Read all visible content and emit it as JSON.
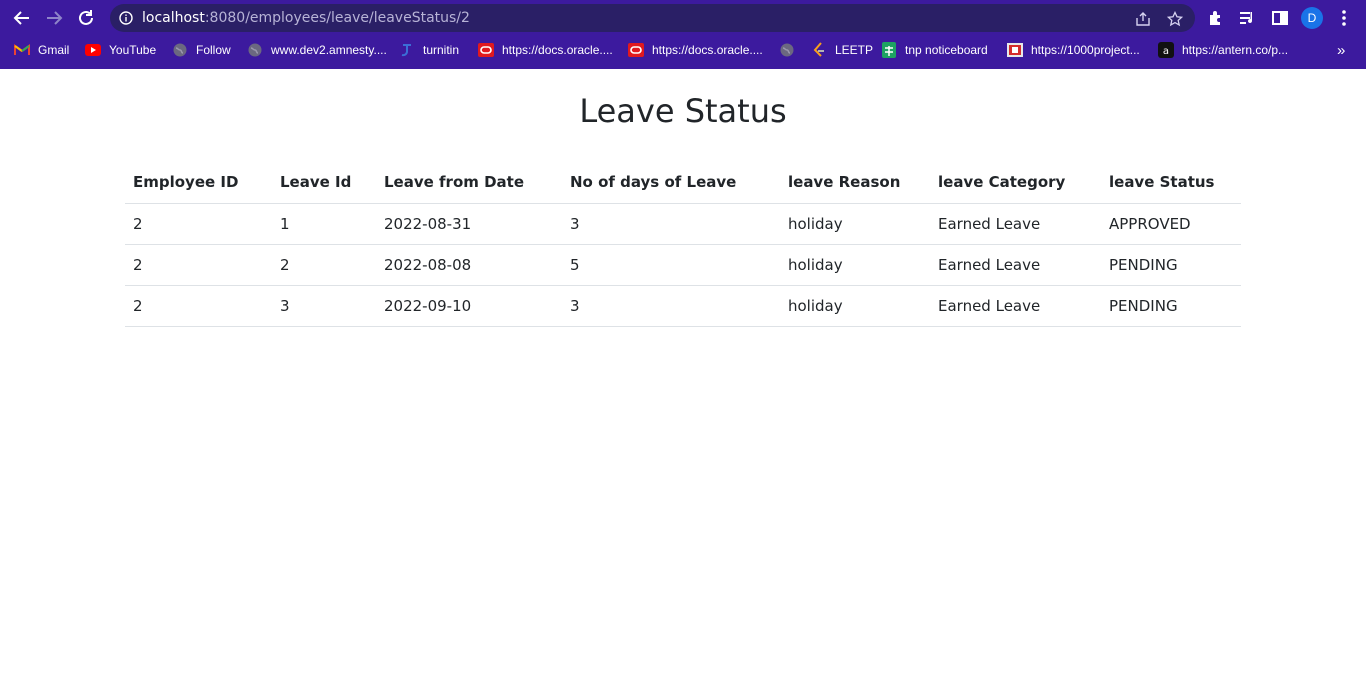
{
  "browser": {
    "url_host": "localhost",
    "url_rest": ":8080/employees/leave/leaveStatus/2",
    "avatar_letter": "D",
    "overflow": "»",
    "bookmarks": [
      {
        "label": "Gmail",
        "icon": "gmail-icon"
      },
      {
        "label": "YouTube",
        "icon": "youtube-icon"
      },
      {
        "label": "Follow",
        "icon": "globe-icon"
      },
      {
        "label": "www.dev2.amnesty....",
        "icon": "globe-icon"
      },
      {
        "label": "turnitin",
        "icon": "turnitin-icon"
      },
      {
        "label": "https://docs.oracle....",
        "icon": "oracle-icon"
      },
      {
        "label": "https://docs.oracle....",
        "icon": "oracle-icon"
      },
      {
        "label": "",
        "icon": "globe-icon"
      },
      {
        "label": "LEETP",
        "icon": "leetcode-icon"
      },
      {
        "label": "tnp noticeboard",
        "icon": "sheets-icon"
      },
      {
        "label": "https://1000project...",
        "icon": "projects-icon"
      },
      {
        "label": "https://antern.co/p...",
        "icon": "antern-icon"
      }
    ]
  },
  "page": {
    "title": "Leave Status",
    "headers": [
      "Employee ID",
      "Leave Id",
      "Leave from Date",
      "No of days of Leave",
      "leave Reason",
      "leave Category",
      "leave Status"
    ],
    "rows": [
      [
        "2",
        "1",
        "2022-08-31",
        "3",
        "holiday",
        "Earned Leave",
        "APPROVED"
      ],
      [
        "2",
        "2",
        "2022-08-08",
        "5",
        "holiday",
        "Earned Leave",
        "PENDING"
      ],
      [
        "2",
        "3",
        "2022-09-10",
        "3",
        "holiday",
        "Earned Leave",
        "PENDING"
      ]
    ]
  }
}
